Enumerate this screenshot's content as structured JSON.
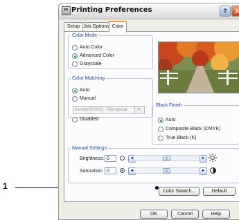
{
  "window": {
    "title": "Printing Preferences"
  },
  "tabs": [
    {
      "label": "Setup"
    },
    {
      "label": "Job Options"
    },
    {
      "label": "Color"
    }
  ],
  "color_mode": {
    "legend": "Color Mode",
    "options": [
      {
        "label": "Auto Color",
        "selected": false
      },
      {
        "label": "Advanced Color",
        "selected": true
      },
      {
        "label": "Grayscale",
        "selected": false
      }
    ]
  },
  "color_matching": {
    "legend": "Color Matching",
    "options": [
      {
        "label": "Auto",
        "selected": true
      },
      {
        "label": "Manual",
        "selected": false
      },
      {
        "label": "Disabled",
        "selected": false
      }
    ],
    "manual_profile": "Monitor(6500K) - Perceptual"
  },
  "black_finish": {
    "legend": "Black Finish",
    "options": [
      {
        "label": "Auto",
        "selected": true
      },
      {
        "label": "Composite Black (CMYK)",
        "selected": false
      },
      {
        "label": "True Black (K)",
        "selected": false
      }
    ]
  },
  "manual_settings": {
    "legend": "Manual Settings",
    "brightness": {
      "label": "Brightness:",
      "value": "0"
    },
    "saturation": {
      "label": "Saturation:",
      "value": "0"
    }
  },
  "buttons": {
    "color_swatch": "Color Swatch...",
    "default": "Default",
    "ok": "OK",
    "cancel": "Cancel",
    "help": "Help"
  },
  "titlebar_buttons": {
    "help": "?",
    "close": "X"
  },
  "callout": {
    "number": "1"
  },
  "icons": {
    "slider_left": "◄",
    "slider_right": "►",
    "slider_thumb": "III"
  },
  "colors": {
    "tab_highlight": "#e8a33c",
    "group_legend": "#1f45a0",
    "radio_selected": "#1aa03a"
  }
}
